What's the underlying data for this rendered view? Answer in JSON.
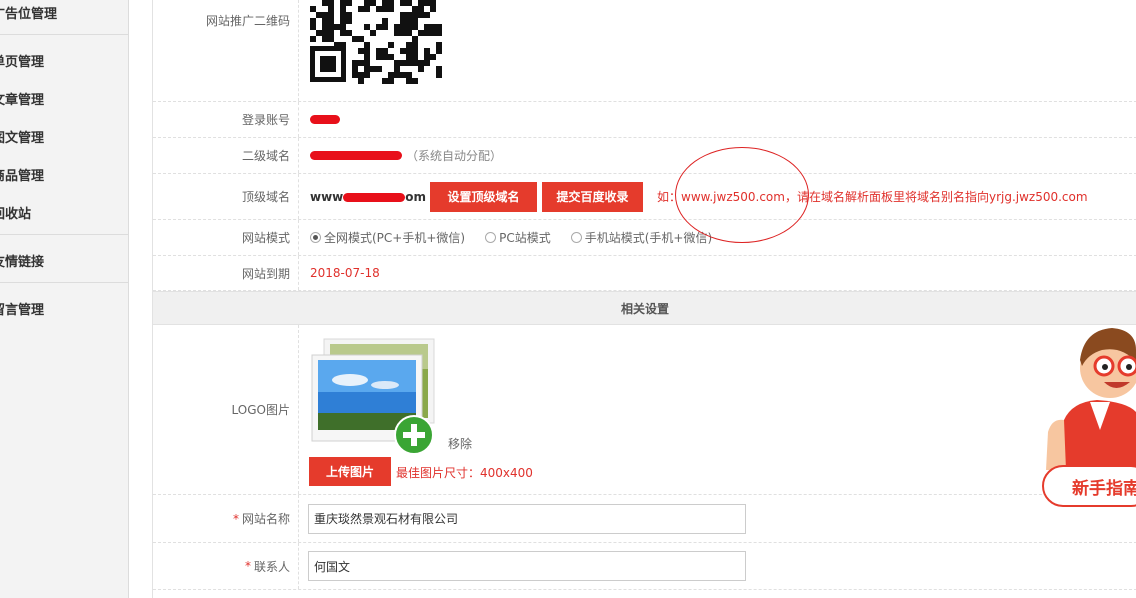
{
  "sidebar": {
    "items": [
      {
        "label": "广告位管理"
      },
      {
        "label": "单页管理"
      },
      {
        "label": "文章管理"
      },
      {
        "label": "图文管理"
      },
      {
        "label": "商品管理"
      },
      {
        "label": "回收站"
      },
      {
        "label": "友情链接"
      },
      {
        "label": "留言管理"
      }
    ]
  },
  "form": {
    "qr_label": "网站推广二维码",
    "login_label": "登录账号",
    "subdomain_label": "二级域名",
    "subdomain_note": "（系统自动分配）",
    "topdomain_label": "顶级域名",
    "topdomain_visible_start": "www",
    "topdomain_visible_end": "om",
    "set_domain_button": "设置顶级域名",
    "submit_baidu_button": "提交百度收录",
    "domain_hint": "如：www.jwz500.com，请在域名解析面板里将域名别名指向yrjg.jwz500.com",
    "mode_label": "网站模式",
    "mode_options": [
      "全网模式(PC+手机+微信)",
      "PC站模式",
      "手机站模式(手机+微信)"
    ],
    "mode_selected": 0,
    "expire_label": "网站到期",
    "expire_value": "2018-07-18",
    "section_title": "相关设置",
    "logo_label": "LOGO图片",
    "remove_label": "移除",
    "upload_button": "上传图片",
    "upload_hint": "最佳图片尺寸：400x400",
    "required_mark": "*",
    "sitename_label": "网站名称",
    "sitename_value": "重庆琰然景观石材有限公司",
    "contact_label": "联系人",
    "contact_value": "何国文"
  },
  "guide": {
    "label": "新手指南"
  },
  "colors": {
    "accent": "#e53b2c",
    "hint": "#e0312c"
  }
}
